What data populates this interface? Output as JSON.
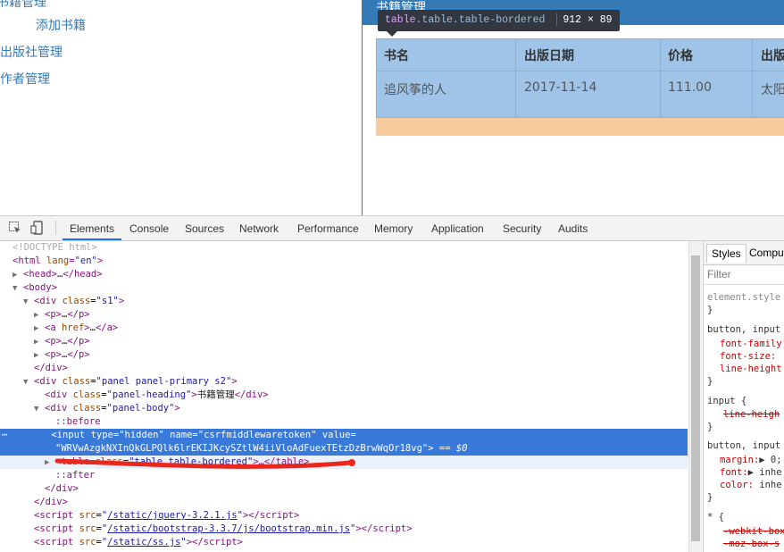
{
  "page": {
    "sidebar": {
      "item0": "书籍管理",
      "item1": "添加书籍",
      "item2": "出版社管理",
      "item3": "作者管理"
    },
    "panel_heading": "书籍管理",
    "table": {
      "headers": [
        "书名",
        "出版日期",
        "价格",
        "出版"
      ],
      "rows": [
        [
          "追风筝的人",
          "2017-11-14",
          "111.00",
          "太阳"
        ]
      ]
    },
    "tooltip": {
      "tag": "table",
      "classes": ".table.table-bordered",
      "size": "912 × 89"
    }
  },
  "devtools": {
    "tabs": [
      "Elements",
      "Console",
      "Sources",
      "Network",
      "Performance",
      "Memory",
      "Application",
      "Security",
      "Audits"
    ],
    "active_tab": "Elements",
    "styles_tabs": [
      "Styles",
      "Comput"
    ],
    "filter_placeholder": "Filter",
    "dom": {
      "doctype": "<!DOCTYPE html>",
      "html_open_tag": "html",
      "html_lang_attr": "lang",
      "html_lang_val": "\"en\"",
      "head": "head",
      "head_ellipsis": "…",
      "body": "body",
      "div_s1_class": "\"s1\"",
      "p": "p",
      "a": "a",
      "a_href": "href",
      "div_panel_class": "\"panel panel-primary s2\"",
      "div_heading_class": "\"panel-heading\"",
      "heading_text": "书籍管理",
      "div_body_class": "\"panel-body\"",
      "before": "::before",
      "after": "::after",
      "input_type": "\"hidden\"",
      "input_name": "\"csrfmiddlewaretoken\"",
      "input_value": "\"WRVwAzgkNXInQkGLPQlk6lrEKIJKcySZtlW4iiVloAdFuexTEtzDzBrwWqOr18vg\"",
      "eq0": "== $0",
      "table_class": "\"table table-bordered\"",
      "script1_src": "/static/jquery-3.2.1.js",
      "script2_src": "/static/bootstrap-3.3.7/js/bootstrap.min.js",
      "script3_src": "/static/ss.js"
    },
    "styles": {
      "element_style": "element.style",
      "rule1_sel": "button, input",
      "rule1_p1": "font-family",
      "rule1_p2": "font-size:",
      "rule1_p3": "line-height",
      "rule2_sel": "input {",
      "rule2_p1": "line-heigh",
      "rule3_sel": "button, input",
      "rule3_p1": "margin:",
      "rule3_v1": "▶ 0;",
      "rule3_p2": "font:",
      "rule3_v2": "▶ inhe",
      "rule3_p3": "color:",
      "rule3_v3": "inhe",
      "rule4_sel": "* {",
      "rule4_p1": "-webkit-box",
      "rule4_p2": "-moz-box-s"
    },
    "annotation_color": "#e8281e"
  }
}
